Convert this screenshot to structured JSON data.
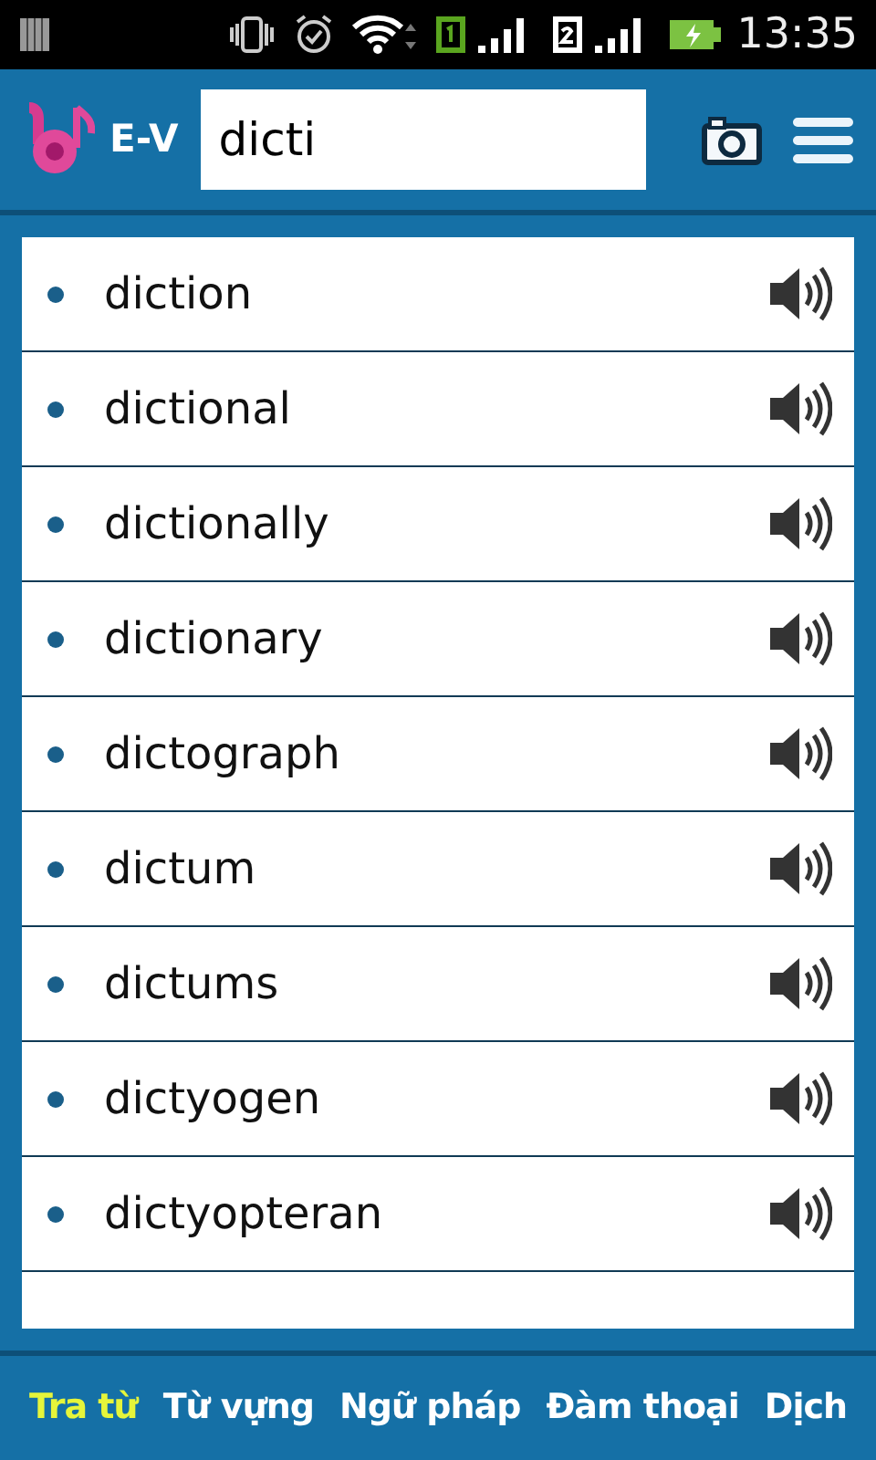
{
  "status_bar": {
    "time": "13:35"
  },
  "header": {
    "lang": "E-V",
    "search": {
      "value": "dicti"
    }
  },
  "results": [
    {
      "word": "diction"
    },
    {
      "word": "dictional"
    },
    {
      "word": "dictionally"
    },
    {
      "word": "dictionary"
    },
    {
      "word": "dictograph"
    },
    {
      "word": "dictum"
    },
    {
      "word": "dictums"
    },
    {
      "word": "dictyogen"
    },
    {
      "word": "dictyopteran"
    }
  ],
  "tabs": [
    {
      "label": "Tra từ",
      "selected": true
    },
    {
      "label": "Từ vựng",
      "selected": false
    },
    {
      "label": "Ngữ pháp",
      "selected": false
    },
    {
      "label": "Đàm thoại",
      "selected": false
    },
    {
      "label": "Dịch",
      "selected": false
    }
  ]
}
